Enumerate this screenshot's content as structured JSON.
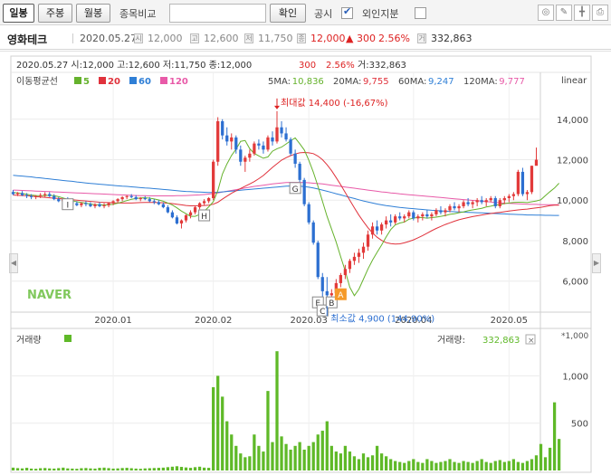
{
  "toolbar": {
    "tab_daily": "일봉",
    "tab_weekly": "주봉",
    "tab_monthly": "월봉",
    "compare_label": "종목비교",
    "compare_input_value": "",
    "confirm_label": "확인",
    "disclosure_label": "공시",
    "disclosure_checked": true,
    "foreign_label": "외인지분",
    "foreign_checked": false,
    "icons": [
      "lightbulb-icon",
      "pencil-icon",
      "crosshair-icon",
      "print-icon"
    ]
  },
  "quote": {
    "name": "영화테크",
    "date": "2020.05.27",
    "open_badge": "시",
    "open": "12,000",
    "high_badge": "고",
    "high": "12,600",
    "low_badge": "저",
    "low": "11,750",
    "close_badge": "종",
    "close": "12,000",
    "change": "▲ 300",
    "change_pct": "2.56%",
    "volume_badge": "거",
    "volume": "332,863"
  },
  "legend": {
    "line1": "2020.05.27  시:12,000  고:12,600  저:11,750  종:12,000",
    "change": "300",
    "change_pct": "2.56%",
    "volume": "거:332,863",
    "ma_title": "이동평균선",
    "ma": [
      {
        "label": "5",
        "color": "#65b22c"
      },
      {
        "label": "20",
        "color": "#e0323c"
      },
      {
        "label": "60",
        "color": "#2f7fd6"
      },
      {
        "label": "120",
        "color": "#e85aa8"
      }
    ],
    "ma_values": [
      {
        "label": "5MA:",
        "value": "10,836",
        "color": "#65b22c"
      },
      {
        "label": "20MA:",
        "value": "9,755",
        "color": "#e0323c"
      },
      {
        "label": "60MA:",
        "value": "9,247",
        "color": "#2f7fd6"
      },
      {
        "label": "120MA:",
        "value": "9,777",
        "color": "#e85aa8"
      }
    ],
    "scale_mode": "linear",
    "max_label": "최대값 14,400 (-16,67%)",
    "min_label": "최소값 4,900 (144,90%)",
    "watermark": "NAVER"
  },
  "volume_panel": {
    "title": "거래량",
    "value_label": "거래량:",
    "value": "332,863",
    "unit": "*1,000",
    "series_color": "#5fb928"
  },
  "chart_data": {
    "type": "candlestick",
    "ylim": [
      4600,
      15600
    ],
    "yticks": [
      6000,
      8000,
      10000,
      12000,
      14000
    ],
    "ytick_labels": [
      "6,000",
      "8,000",
      "10,000",
      "12,000",
      "14,000"
    ],
    "x_labels": [
      {
        "label": "2020.01",
        "index": 22
      },
      {
        "label": "2020.02",
        "index": 44
      },
      {
        "label": "2020.03",
        "index": 65
      },
      {
        "label": "2020.04",
        "index": 88
      },
      {
        "label": "2020.05",
        "index": 109
      }
    ],
    "up_color": "#e23a3a",
    "down_color": "#2c6fd1",
    "ohlc": [
      [
        10400,
        10500,
        10250,
        10300
      ],
      [
        10300,
        10400,
        10200,
        10350
      ],
      [
        10350,
        10450,
        10200,
        10250
      ],
      [
        10250,
        10350,
        10100,
        10200
      ],
      [
        10200,
        10300,
        10050,
        10150
      ],
      [
        10150,
        10250,
        10050,
        10200
      ],
      [
        10200,
        10350,
        10100,
        10250
      ],
      [
        10250,
        10400,
        10150,
        10300
      ],
      [
        10300,
        10400,
        10150,
        10200
      ],
      [
        10200,
        10300,
        10000,
        10050
      ],
      [
        10050,
        10150,
        9900,
        9950
      ],
      [
        9950,
        10100,
        9850,
        10050
      ],
      [
        10050,
        10150,
        9900,
        9950
      ],
      [
        9950,
        10050,
        9800,
        9850
      ],
      [
        9850,
        9950,
        9700,
        9750
      ],
      [
        9750,
        9900,
        9650,
        9850
      ],
      [
        9850,
        9950,
        9700,
        9800
      ],
      [
        9800,
        9900,
        9650,
        9700
      ],
      [
        9700,
        9850,
        9600,
        9800
      ],
      [
        9800,
        9900,
        9650,
        9700
      ],
      [
        9700,
        9850,
        9600,
        9750
      ],
      [
        9750,
        9900,
        9650,
        9850
      ],
      [
        9850,
        10000,
        9750,
        9950
      ],
      [
        9950,
        10100,
        9850,
        10050
      ],
      [
        10050,
        10200,
        9950,
        10150
      ],
      [
        10150,
        10250,
        10050,
        10200
      ],
      [
        10200,
        10300,
        10100,
        10150
      ],
      [
        10150,
        10250,
        10000,
        10050
      ],
      [
        10050,
        10150,
        9950,
        10100
      ],
      [
        10100,
        10200,
        10000,
        10050
      ],
      [
        10050,
        10150,
        9900,
        9950
      ],
      [
        9950,
        10050,
        9800,
        9900
      ],
      [
        9900,
        10000,
        9750,
        9800
      ],
      [
        9800,
        9900,
        9600,
        9650
      ],
      [
        9650,
        9750,
        9350,
        9400
      ],
      [
        9400,
        9500,
        9100,
        9150
      ],
      [
        9150,
        9250,
        8800,
        8850
      ],
      [
        8850,
        9050,
        8600,
        9000
      ],
      [
        9000,
        9300,
        8900,
        9250
      ],
      [
        9250,
        9500,
        9100,
        9400
      ],
      [
        9400,
        9700,
        9300,
        9650
      ],
      [
        9650,
        9900,
        9550,
        9850
      ],
      [
        9850,
        10050,
        9750,
        9950
      ],
      [
        9950,
        10150,
        9850,
        10100
      ],
      [
        10100,
        12000,
        10000,
        11900
      ],
      [
        11900,
        14100,
        11700,
        13900
      ],
      [
        13900,
        14000,
        13000,
        13200
      ],
      [
        13200,
        13600,
        12700,
        12900
      ],
      [
        12900,
        13300,
        12500,
        13100
      ],
      [
        13100,
        13200,
        12300,
        12500
      ],
      [
        12500,
        12700,
        11700,
        11900
      ],
      [
        11900,
        12200,
        11400,
        12100
      ],
      [
        12100,
        12500,
        11900,
        12300
      ],
      [
        12300,
        12900,
        12200,
        12800
      ],
      [
        12800,
        13000,
        12500,
        12700
      ],
      [
        12700,
        12900,
        12300,
        12500
      ],
      [
        12500,
        13200,
        12400,
        13100
      ],
      [
        13100,
        13400,
        12700,
        12900
      ],
      [
        12900,
        14400,
        12800,
        13600
      ],
      [
        13600,
        13900,
        13100,
        13300
      ],
      [
        13300,
        13600,
        12900,
        13000
      ],
      [
        13000,
        13100,
        12200,
        12300
      ],
      [
        12300,
        12500,
        11600,
        11800
      ],
      [
        11800,
        11900,
        10900,
        11000
      ],
      [
        11000,
        11100,
        9700,
        9800
      ],
      [
        9800,
        9900,
        8800,
        8900
      ],
      [
        8900,
        9000,
        7800,
        7900
      ],
      [
        7900,
        8000,
        6100,
        6200
      ],
      [
        6200,
        6400,
        5100,
        5500
      ],
      [
        5500,
        6200,
        4900,
        5300
      ],
      [
        5300,
        5600,
        4950,
        5400
      ],
      [
        5400,
        6100,
        5300,
        5900
      ],
      [
        5900,
        6400,
        5700,
        6300
      ],
      [
        6300,
        6800,
        6100,
        6600
      ],
      [
        6600,
        7100,
        6400,
        7000
      ],
      [
        7000,
        7400,
        6800,
        7200
      ],
      [
        7200,
        7600,
        6900,
        7400
      ],
      [
        7400,
        7900,
        7100,
        7700
      ],
      [
        7700,
        8500,
        7500,
        8300
      ],
      [
        8300,
        8900,
        8100,
        8700
      ],
      [
        8700,
        9000,
        8300,
        8500
      ],
      [
        8500,
        8900,
        8300,
        8800
      ],
      [
        8800,
        9200,
        8600,
        9000
      ],
      [
        9000,
        9300,
        8700,
        8900
      ],
      [
        8900,
        9300,
        8800,
        9200
      ],
      [
        9200,
        9400,
        9000,
        9100
      ],
      [
        9100,
        9300,
        8900,
        9200
      ],
      [
        9200,
        9500,
        9100,
        9400
      ],
      [
        9400,
        9500,
        9000,
        9100
      ],
      [
        9100,
        9300,
        8900,
        9200
      ],
      [
        9200,
        9400,
        9000,
        9300
      ],
      [
        9300,
        9500,
        9100,
        9200
      ],
      [
        9200,
        9400,
        9000,
        9300
      ],
      [
        9300,
        9600,
        9200,
        9500
      ],
      [
        9500,
        9700,
        9300,
        9400
      ],
      [
        9400,
        9600,
        9200,
        9500
      ],
      [
        9500,
        9800,
        9400,
        9700
      ],
      [
        9700,
        9900,
        9500,
        9600
      ],
      [
        9600,
        9800,
        9400,
        9700
      ],
      [
        9700,
        10000,
        9600,
        9900
      ],
      [
        9900,
        10100,
        9700,
        9800
      ],
      [
        9800,
        10000,
        9600,
        9900
      ],
      [
        9900,
        10100,
        9700,
        10000
      ],
      [
        10000,
        10200,
        9800,
        9900
      ],
      [
        9900,
        10100,
        9700,
        10000
      ],
      [
        10000,
        10200,
        9900,
        10100
      ],
      [
        10100,
        10200,
        9600,
        9700
      ],
      [
        9700,
        10100,
        9600,
        10000
      ],
      [
        10000,
        10200,
        9800,
        10100
      ],
      [
        10100,
        10300,
        9900,
        10200
      ],
      [
        10200,
        10400,
        10000,
        10300
      ],
      [
        10300,
        11500,
        10200,
        11400
      ],
      [
        11400,
        11600,
        10200,
        10300
      ],
      [
        10300,
        10500,
        10000,
        10400
      ],
      [
        10400,
        11700,
        10300,
        11700
      ],
      [
        11700,
        12600,
        11750,
        12000
      ]
    ],
    "ma5": [
      10380,
      10360,
      10330,
      10290,
      10250,
      10230,
      10220,
      10230,
      10240,
      10220,
      10170,
      10110,
      10040,
      9980,
      9920,
      9890,
      9850,
      9810,
      9780,
      9770,
      9760,
      9770,
      9800,
      9850,
      9910,
      9980,
      10040,
      10080,
      10110,
      10120,
      10100,
      10060,
      10010,
      9950,
      9860,
      9760,
      9620,
      9460,
      9330,
      9200,
      9200,
      9290,
      9450,
      9670,
      9930,
      10480,
      11290,
      11790,
      12210,
      12520,
      12910,
      12950,
      12540,
      12310,
      12190,
      12070,
      12140,
      12420,
      12540,
      12620,
      12780,
      12940,
      13080,
      12790,
      12480,
      11970,
      11380,
      10700,
      9940,
      9200,
      8570,
      7940,
      7200,
      6500,
      5700,
      5280,
      5600,
      6100,
      6600,
      7040,
      7420,
      7790,
      8180,
      8550,
      8780,
      8870,
      8920,
      9060,
      9110,
      9150,
      9140,
      9110,
      9140,
      9160,
      9200,
      9240,
      9300,
      9330,
      9380,
      9420,
      9480,
      9520,
      9560,
      9600,
      9660,
      9700,
      9760,
      9780,
      9830,
      9860,
      9890,
      9900,
      9900,
      9880,
      9920,
      9960,
      10020,
      10220,
      10420,
      10600,
      10836
    ],
    "ma20": [
      10250,
      10240,
      10230,
      10220,
      10200,
      10180,
      10160,
      10140,
      10120,
      10100,
      10080,
      10060,
      10040,
      10020,
      10000,
      9980,
      9960,
      9940,
      9920,
      9900,
      9890,
      9880,
      9870,
      9860,
      9860,
      9860,
      9860,
      9870,
      9880,
      9890,
      9890,
      9890,
      9880,
      9870,
      9850,
      9830,
      9800,
      9770,
      9740,
      9720,
      9720,
      9730,
      9740,
      9750,
      9800,
      9900,
      10050,
      10200,
      10340,
      10460,
      10580,
      10690,
      10800,
      10920,
      11060,
      11220,
      11420,
      11620,
      11800,
      11980,
      12100,
      12200,
      12280,
      12340,
      12360,
      12340,
      12300,
      12180,
      12000,
      11750,
      11460,
      11120,
      10760,
      10380,
      10000,
      9620,
      9260,
      8940,
      8640,
      8380,
      8170,
      8010,
      7900,
      7850,
      7830,
      7840,
      7890,
      7960,
      8040,
      8140,
      8250,
      8370,
      8490,
      8600,
      8700,
      8800,
      8880,
      8960,
      9030,
      9090,
      9140,
      9190,
      9230,
      9270,
      9310,
      9340,
      9370,
      9400,
      9430,
      9460,
      9490,
      9520,
      9540,
      9560,
      9590,
      9620,
      9650,
      9690,
      9730,
      9755,
      9755
    ],
    "ma60": [
      11230,
      11210,
      11190,
      11170,
      11150,
      11120,
      11100,
      11070,
      11050,
      11020,
      11000,
      10970,
      10950,
      10930,
      10900,
      10880,
      10850,
      10830,
      10810,
      10790,
      10770,
      10750,
      10730,
      10710,
      10690,
      10680,
      10660,
      10640,
      10620,
      10600,
      10590,
      10570,
      10550,
      10530,
      10510,
      10490,
      10470,
      10450,
      10430,
      10420,
      10410,
      10400,
      10390,
      10380,
      10380,
      10390,
      10410,
      10430,
      10450,
      10470,
      10490,
      10510,
      10530,
      10550,
      10570,
      10590,
      10610,
      10630,
      10650,
      10670,
      10690,
      10700,
      10700,
      10690,
      10670,
      10640,
      10600,
      10550,
      10500,
      10440,
      10380,
      10320,
      10260,
      10200,
      10140,
      10080,
      10020,
      9960,
      9910,
      9860,
      9810,
      9770,
      9730,
      9700,
      9670,
      9640,
      9620,
      9600,
      9580,
      9560,
      9540,
      9520,
      9500,
      9490,
      9470,
      9460,
      9440,
      9430,
      9420,
      9410,
      9400,
      9390,
      9380,
      9370,
      9360,
      9350,
      9340,
      9330,
      9320,
      9310,
      9300,
      9290,
      9280,
      9270,
      9270,
      9260,
      9260,
      9250,
      9250,
      9247,
      9247
    ],
    "ma120": [
      10500,
      10490,
      10480,
      10470,
      10460,
      10450,
      10440,
      10430,
      10420,
      10410,
      10400,
      10390,
      10380,
      10370,
      10360,
      10350,
      10340,
      10330,
      10320,
      10310,
      10300,
      10290,
      10280,
      10270,
      10260,
      10250,
      10240,
      10230,
      10220,
      10220,
      10210,
      10210,
      10210,
      10210,
      10210,
      10210,
      10220,
      10220,
      10230,
      10240,
      10250,
      10260,
      10280,
      10300,
      10330,
      10360,
      10400,
      10440,
      10480,
      10520,
      10560,
      10600,
      10640,
      10680,
      10710,
      10740,
      10770,
      10800,
      10830,
      10850,
      10870,
      10880,
      10880,
      10880,
      10870,
      10860,
      10840,
      10820,
      10800,
      10770,
      10740,
      10710,
      10680,
      10650,
      10620,
      10590,
      10560,
      10530,
      10500,
      10470,
      10440,
      10410,
      10390,
      10360,
      10340,
      10310,
      10290,
      10270,
      10250,
      10230,
      10210,
      10190,
      10170,
      10150,
      10130,
      10110,
      10090,
      10070,
      10050,
      10030,
      10010,
      9990,
      9970,
      9950,
      9930,
      9910,
      9890,
      9870,
      9850,
      9840,
      9830,
      9820,
      9810,
      9800,
      9790,
      9790,
      9780,
      9780,
      9780,
      9777,
      9777
    ],
    "volume_ylim": [
      0,
      1300
    ],
    "volume_yticks": [
      500,
      1000
    ],
    "volume_ytick_labels": [
      "500",
      "1,000"
    ],
    "volume": [
      30,
      25,
      22,
      28,
      20,
      18,
      24,
      26,
      22,
      20,
      25,
      30,
      22,
      20,
      18,
      24,
      26,
      22,
      20,
      28,
      30,
      25,
      20,
      22,
      26,
      28,
      24,
      20,
      18,
      22,
      24,
      26,
      28,
      30,
      35,
      40,
      45,
      38,
      32,
      28,
      35,
      40,
      30,
      28,
      880,
      1000,
      780,
      520,
      380,
      260,
      180,
      140,
      150,
      380,
      260,
      200,
      840,
      300,
      1260,
      360,
      280,
      220,
      260,
      300,
      220,
      260,
      300,
      380,
      420,
      520,
      260,
      200,
      180,
      260,
      200,
      150,
      120,
      180,
      140,
      160,
      260,
      180,
      150,
      120,
      100,
      90,
      80,
      100,
      120,
      90,
      80,
      120,
      100,
      80,
      90,
      100,
      120,
      90,
      80,
      100,
      90,
      80,
      100,
      120,
      90,
      80,
      100,
      110,
      90,
      100,
      120,
      90,
      80,
      100,
      120,
      160,
      280,
      140,
      240,
      720,
      333
    ],
    "markers": [
      {
        "label": "I",
        "index": 12,
        "price": 9800,
        "tone": "plain"
      },
      {
        "label": "H",
        "index": 42,
        "price": 9250,
        "tone": "plain"
      },
      {
        "label": "G",
        "index": 62,
        "price": 10600,
        "tone": "plain"
      },
      {
        "label": "E",
        "index": 67,
        "price": 4950,
        "tone": "plain"
      },
      {
        "label": "C",
        "index": 68,
        "price": 4550,
        "tone": "plain"
      },
      {
        "label": "B",
        "index": 70,
        "price": 4950,
        "tone": "plain"
      },
      {
        "label": "A",
        "index": 72,
        "price": 5350,
        "tone": "orange"
      }
    ],
    "max_point": {
      "index": 58,
      "price": 14400
    },
    "min_point": {
      "index": 69,
      "price": 4900
    }
  }
}
